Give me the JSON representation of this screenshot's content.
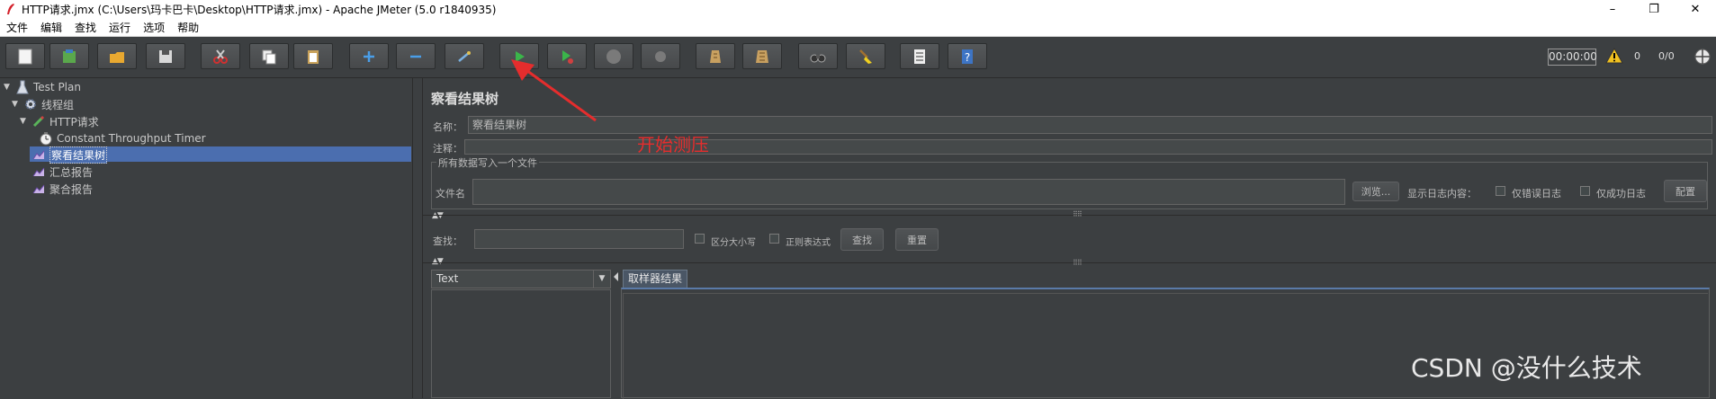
{
  "window": {
    "title": "HTTP请求.jmx (C:\\Users\\玛卡巴卡\\Desktop\\HTTP请求.jmx) - Apache JMeter (5.0 r1840935)",
    "minimize": "–",
    "restore": "❐",
    "close": "✕"
  },
  "menu": [
    "文件",
    "编辑",
    "查找",
    "运行",
    "选项",
    "帮助"
  ],
  "toolbar": {
    "icons": [
      "new-icon",
      "templates-icon",
      "open-icon",
      "save-icon",
      "cut-icon",
      "copy-icon",
      "paste-icon",
      "expand-icon",
      "collapse-icon",
      "toggle-icon",
      "start-icon",
      "start-no-pause-icon",
      "stop-icon",
      "shutdown-icon",
      "clear-icon",
      "clear-all-icon",
      "search-icon",
      "reset-search-icon",
      "function-helper-icon",
      "help-icon"
    ],
    "timer": "00:00:00",
    "warning_count": "0",
    "thread_count": "0/0"
  },
  "tree": {
    "items": [
      {
        "label": "Test Plan"
      },
      {
        "label": "线程组"
      },
      {
        "label": "HTTP请求"
      },
      {
        "label": "Constant Throughput Timer"
      },
      {
        "label": "察看结果树"
      },
      {
        "label": "汇总报告"
      },
      {
        "label": "聚合报告"
      }
    ]
  },
  "panel": {
    "title": "察看结果树",
    "name_label": "名称：",
    "name_value": "察看结果树",
    "comment_label": "注释：",
    "comment_value": "",
    "group_title": "所有数据写入一个文件",
    "file_label": "文件名",
    "file_value": "",
    "browse_button": "浏览...",
    "log_label": "显示日志内容：",
    "errors_only": "仅错误日志",
    "success_only": "仅成功日志",
    "configure_button": "配置",
    "search_label": "查找：",
    "search_value": "",
    "case_sensitive": "区分大小写",
    "regex": "正则表达式",
    "find_button": "查找",
    "reset_button": "重置",
    "renderer_selected": "Text",
    "tab_label": "取样器结果"
  },
  "annotation": {
    "text": "开始测压",
    "color": "#e52d2d"
  },
  "watermark": "CSDN @没什么技术"
}
